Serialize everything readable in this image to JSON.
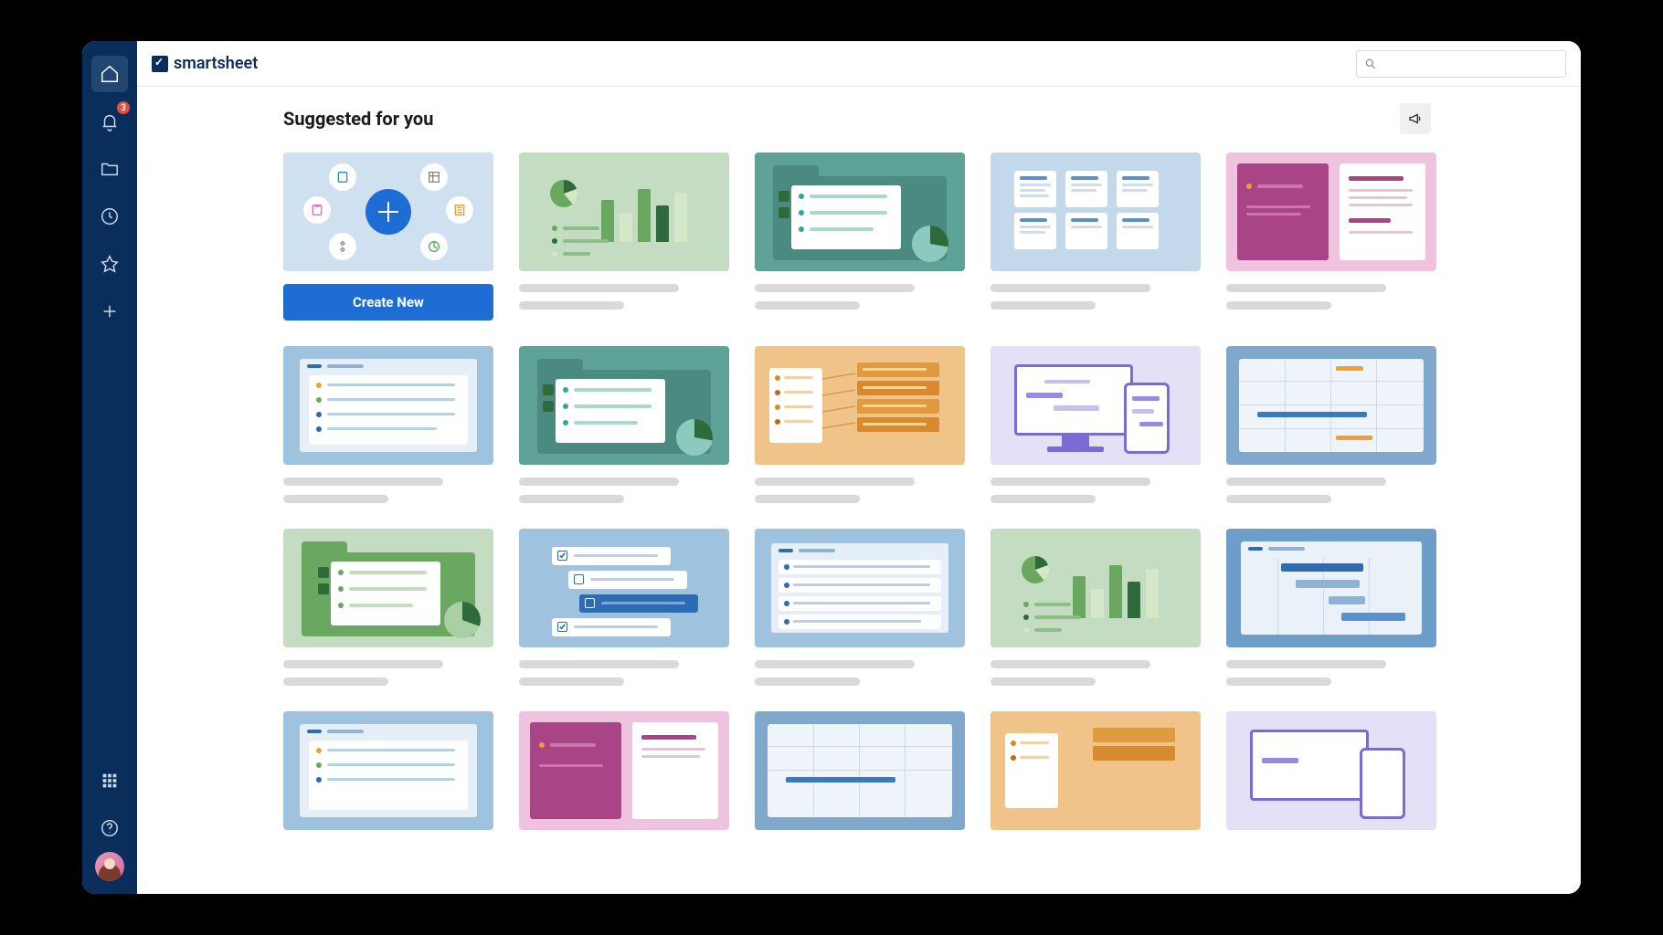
{
  "brand": {
    "name": "smartsheet"
  },
  "sidebar": {
    "notifications_count": "3",
    "items": [
      {
        "name": "home-icon"
      },
      {
        "name": "bell-icon"
      },
      {
        "name": "folder-icon"
      },
      {
        "name": "clock-icon"
      },
      {
        "name": "star-icon"
      },
      {
        "name": "plus-icon"
      }
    ],
    "footer": [
      {
        "name": "apps-icon"
      },
      {
        "name": "help-icon"
      },
      {
        "name": "avatar"
      }
    ]
  },
  "search": {
    "placeholder": ""
  },
  "main": {
    "heading": "Suggested for you",
    "create_button_label": "Create New"
  },
  "template_cards": [
    {
      "style": "create"
    },
    {
      "style": "green-chart"
    },
    {
      "style": "teal-folder-list"
    },
    {
      "style": "blue-kanban"
    },
    {
      "style": "magenta-doc"
    },
    {
      "style": "blue-list"
    },
    {
      "style": "teal-folder-list"
    },
    {
      "style": "orange-map"
    },
    {
      "style": "lilac-devices"
    },
    {
      "style": "blue-calendar"
    },
    {
      "style": "green-folder-list"
    },
    {
      "style": "blue-checklist"
    },
    {
      "style": "blue-rows"
    },
    {
      "style": "green-chart"
    },
    {
      "style": "blue-gantt"
    },
    {
      "style": "blue-list"
    },
    {
      "style": "magenta-doc"
    },
    {
      "style": "blue-calendar"
    },
    {
      "style": "orange-map"
    },
    {
      "style": "lilac-devices"
    }
  ]
}
